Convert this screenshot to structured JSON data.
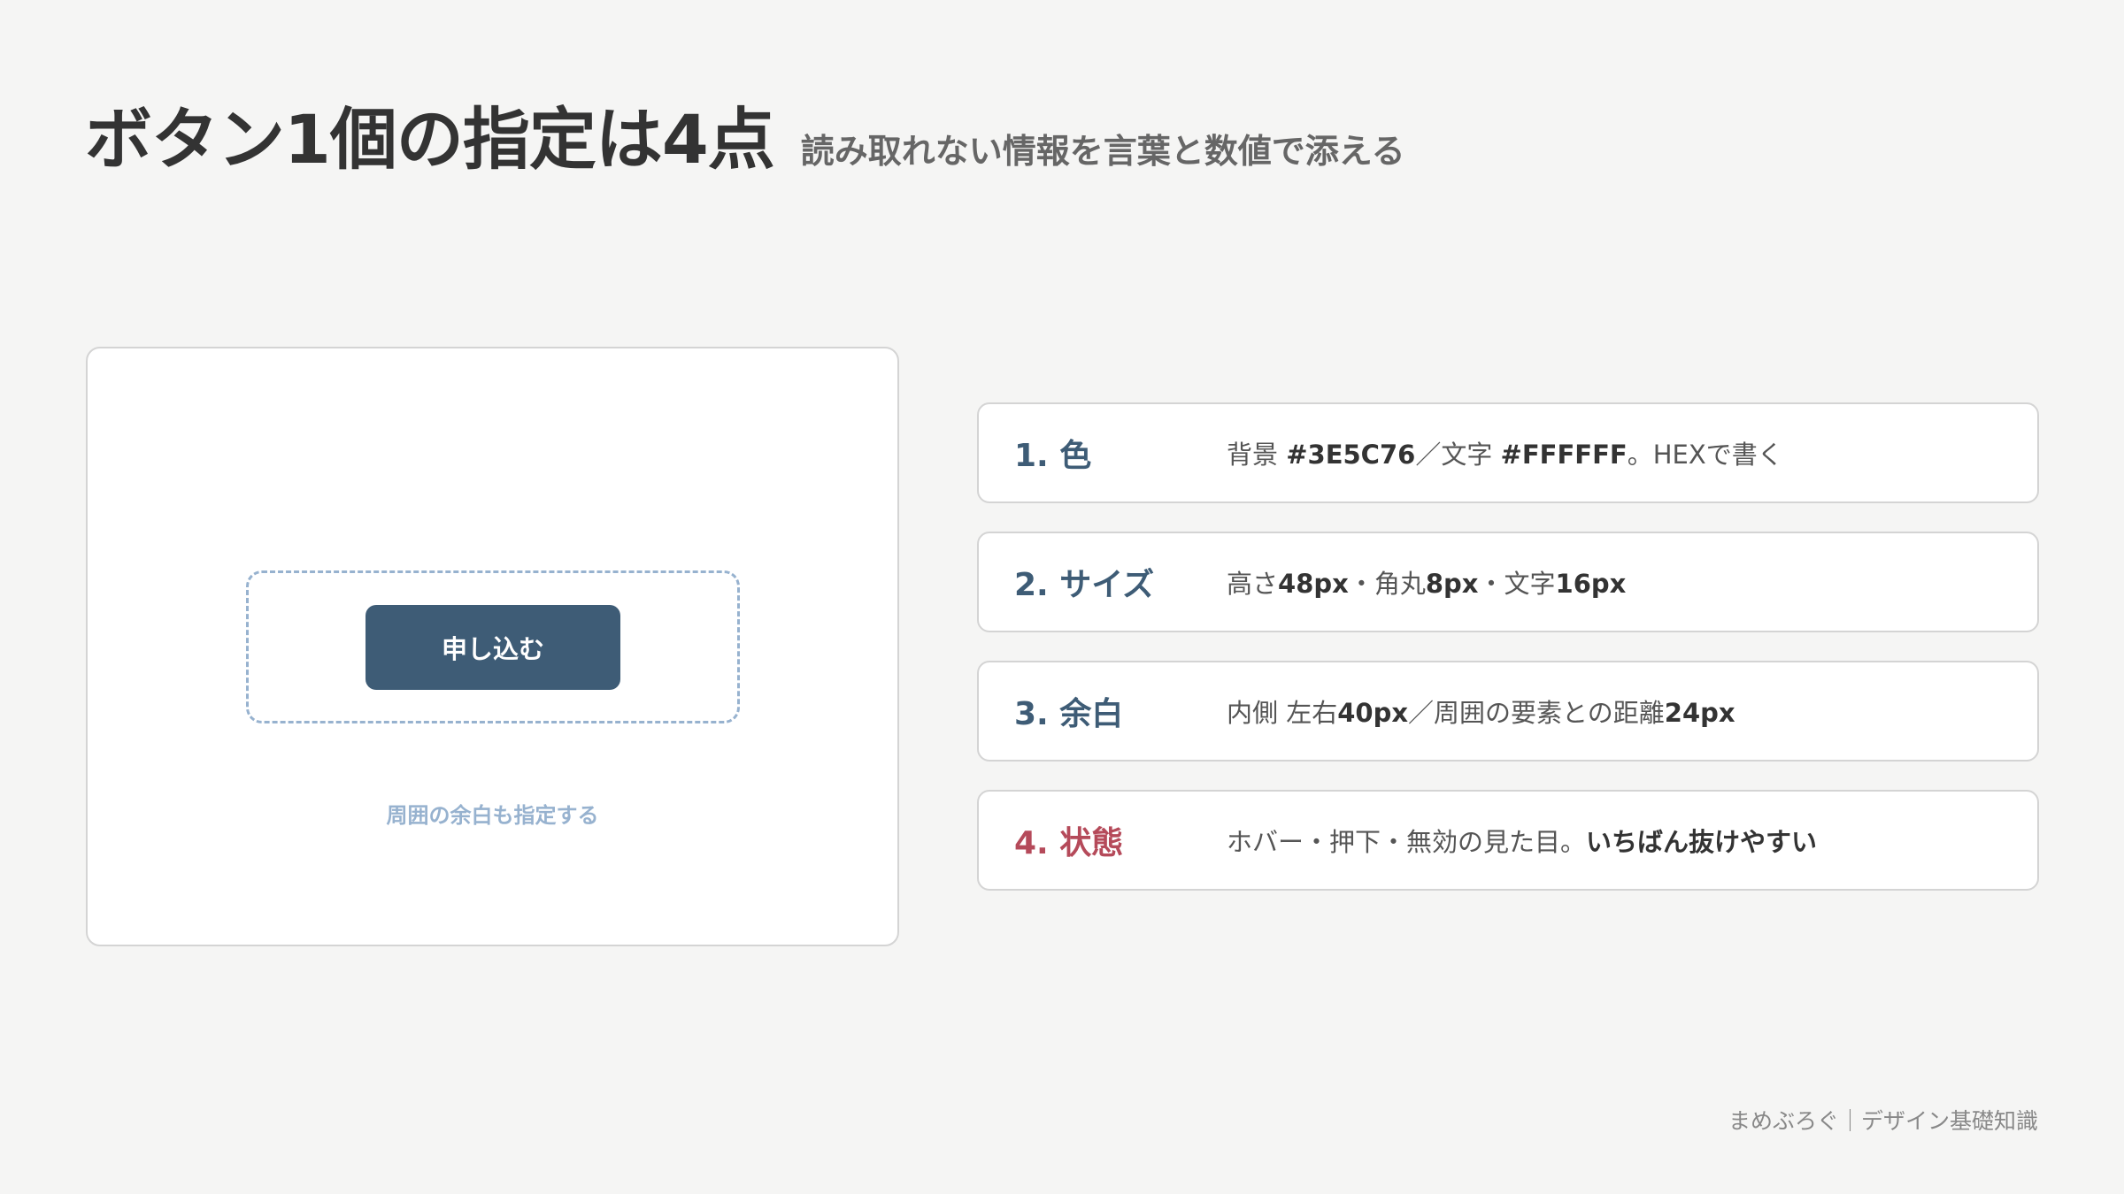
{
  "header": {
    "title": "ボタン1個の指定は4点",
    "subtitle": "読み取れない情報を言葉と数値で添える"
  },
  "demo": {
    "button_label": "申し込む",
    "caption": "周囲の余白も指定する"
  },
  "points": [
    {
      "label": "1. 色",
      "desc": [
        "背景 ",
        "#3E5C76",
        "／文字 ",
        "#FFFFFF",
        "。HEXで書く"
      ]
    },
    {
      "label": "2. サイズ",
      "desc": [
        "高さ",
        "48px",
        "・角丸",
        "8px",
        "・文字",
        "16px"
      ]
    },
    {
      "label": "3. 余白",
      "desc": [
        "内側 左右",
        "40px",
        "／周囲の要素との距離",
        "24px"
      ]
    },
    {
      "label": "4. 状態",
      "desc": [
        "ホバー・押下・無効の見た目。",
        "いちばん抜けやすい"
      ]
    }
  ],
  "footer": {
    "text": "まめぶろぐ｜デザイン基礎知識"
  },
  "colors": {
    "button_bg": "#3E5C76",
    "button_text": "#FFFFFF",
    "accent": "#3E5C76",
    "alert": "#B54A5A",
    "dashed_frame": "#97B2CF"
  }
}
